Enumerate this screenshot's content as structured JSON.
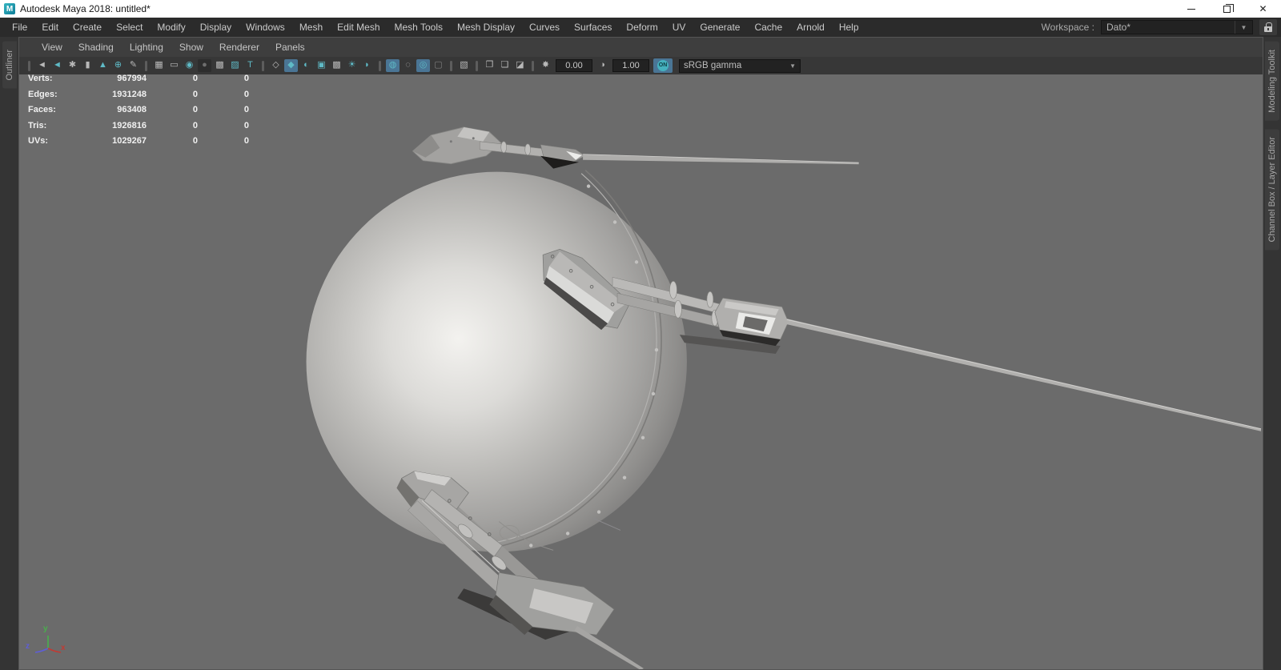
{
  "window": {
    "title": "Autodesk Maya 2018: untitled*",
    "app_icon": "maya-logo",
    "controls": [
      "minimize",
      "restore",
      "close"
    ]
  },
  "menubar": {
    "items": [
      "File",
      "Edit",
      "Create",
      "Select",
      "Modify",
      "Display",
      "Windows",
      "Mesh",
      "Edit Mesh",
      "Mesh Tools",
      "Mesh Display",
      "Curves",
      "Surfaces",
      "Deform",
      "UV",
      "Generate",
      "Cache",
      "Arnold",
      "Help"
    ],
    "workspace_label": "Workspace :",
    "workspace_value": "Dato*"
  },
  "panel_menu": {
    "items": [
      "View",
      "Shading",
      "Lighting",
      "Show",
      "Renderer",
      "Panels"
    ]
  },
  "toolbar": {
    "exposure_value": "0.00",
    "contrast_value": "1.00",
    "toggle_label": "ON",
    "gamma_value": "sRGB gamma",
    "items": [
      {
        "type": "sep"
      },
      {
        "type": "icon",
        "name": "select-camera-icon",
        "glyph": "◄",
        "color": "gray"
      },
      {
        "type": "icon",
        "name": "lock-camera-icon",
        "glyph": "◄",
        "color": "teal"
      },
      {
        "type": "icon",
        "name": "camera-attributes-icon",
        "glyph": "✱",
        "color": "gray"
      },
      {
        "type": "icon",
        "name": "bookmark-icon",
        "glyph": "▮",
        "color": "gray"
      },
      {
        "type": "icon",
        "name": "image-plane-icon",
        "glyph": "▲",
        "color": "teal"
      },
      {
        "type": "icon",
        "name": "pan-zoom-icon",
        "glyph": "⊕",
        "color": "teal"
      },
      {
        "type": "icon",
        "name": "grease-pencil-icon",
        "glyph": "✎",
        "color": "gray"
      },
      {
        "type": "sep"
      },
      {
        "type": "icon",
        "name": "grid-icon",
        "glyph": "▦",
        "color": "gray"
      },
      {
        "type": "icon",
        "name": "film-gate-icon",
        "glyph": "▭",
        "color": "gray"
      },
      {
        "type": "icon",
        "name": "resolution-gate-icon",
        "glyph": "◉",
        "color": "teal"
      },
      {
        "type": "icon",
        "name": "gate-mask-icon",
        "glyph": "●",
        "color": "dim",
        "state": "sunken"
      },
      {
        "type": "icon",
        "name": "field-chart-icon",
        "glyph": "▩",
        "color": "gray"
      },
      {
        "type": "icon",
        "name": "safe-action-icon",
        "glyph": "▨",
        "color": "teal"
      },
      {
        "type": "icon",
        "name": "safe-title-icon",
        "glyph": "T",
        "color": "teal"
      },
      {
        "type": "sep"
      },
      {
        "type": "icon",
        "name": "wireframe-icon",
        "glyph": "◇",
        "color": "gray"
      },
      {
        "type": "icon",
        "name": "shaded-icon",
        "glyph": "◆",
        "color": "teal",
        "state": "active"
      },
      {
        "type": "icon",
        "name": "wireframe-on-shaded-icon",
        "glyph": "◐",
        "color": "teal"
      },
      {
        "type": "icon",
        "name": "textured-icon",
        "glyph": "▣",
        "color": "teal"
      },
      {
        "type": "icon",
        "name": "use-default-material-icon",
        "glyph": "▩",
        "color": "gray"
      },
      {
        "type": "icon",
        "name": "lighting-icon",
        "glyph": "☀",
        "color": "teal"
      },
      {
        "type": "icon",
        "name": "shadows-icon",
        "glyph": "◗",
        "color": "teal"
      },
      {
        "type": "sep"
      },
      {
        "type": "icon",
        "name": "occlusion-icon",
        "glyph": "◍",
        "color": "teal",
        "state": "active"
      },
      {
        "type": "icon",
        "name": "motion-blur-icon",
        "glyph": "◌",
        "color": "gray"
      },
      {
        "type": "icon",
        "name": "antialias-icon",
        "glyph": "◎",
        "color": "teal",
        "state": "active"
      },
      {
        "type": "icon",
        "name": "depth-of-field-icon",
        "glyph": "▢",
        "color": "dim"
      },
      {
        "type": "sep"
      },
      {
        "type": "icon",
        "name": "isolate-select-icon",
        "glyph": "▧",
        "color": "gray"
      },
      {
        "type": "sep"
      },
      {
        "type": "icon",
        "name": "xray-icon",
        "glyph": "❐",
        "color": "gray"
      },
      {
        "type": "icon",
        "name": "xray-joints-icon",
        "glyph": "❏",
        "color": "gray"
      },
      {
        "type": "icon",
        "name": "xray-active-icon",
        "glyph": "◪",
        "color": "gray"
      },
      {
        "type": "sep"
      },
      {
        "type": "icon",
        "name": "exposure-icon",
        "glyph": "✸",
        "color": "gray"
      },
      {
        "type": "field",
        "name": "exposure-field",
        "bind": "exposure_value"
      },
      {
        "type": "icon",
        "name": "contrast-icon",
        "glyph": "◑",
        "color": "gray"
      },
      {
        "type": "field",
        "name": "contrast-field",
        "bind": "contrast_value"
      },
      {
        "type": "toggle",
        "name": "color-management-toggle",
        "bind": "toggle_label"
      },
      {
        "type": "dropdown",
        "name": "gamma-dropdown",
        "bind": "gamma_value"
      }
    ]
  },
  "hud": {
    "rows": [
      {
        "label": "Verts:",
        "total": "967994",
        "col2": "0",
        "col3": "0"
      },
      {
        "label": "Edges:",
        "total": "1931248",
        "col2": "0",
        "col3": "0"
      },
      {
        "label": "Faces:",
        "total": "963408",
        "col2": "0",
        "col3": "0"
      },
      {
        "label": "Tris:",
        "total": "1926816",
        "col2": "0",
        "col3": "0"
      },
      {
        "label": "UVs:",
        "total": "1029267",
        "col2": "0",
        "col3": "0"
      }
    ]
  },
  "side_tabs": {
    "left": [
      "Outliner"
    ],
    "right": [
      "Modeling Toolkit",
      "Channel Box / Layer Editor"
    ]
  },
  "viewport": {
    "background": "#6b6b6b",
    "model": "sputnik-satellite",
    "axis": {
      "x": "x",
      "y": "y",
      "z": "z",
      "x_color": "#c23a33",
      "y_color": "#49b04c",
      "z_color": "#5e5ed8"
    }
  },
  "colors": {
    "accent_teal": "#5fbac6",
    "active_button": "#4a7595",
    "menubar_bg": "#2b2b2b",
    "viewport_bg": "#6b6b6b"
  }
}
